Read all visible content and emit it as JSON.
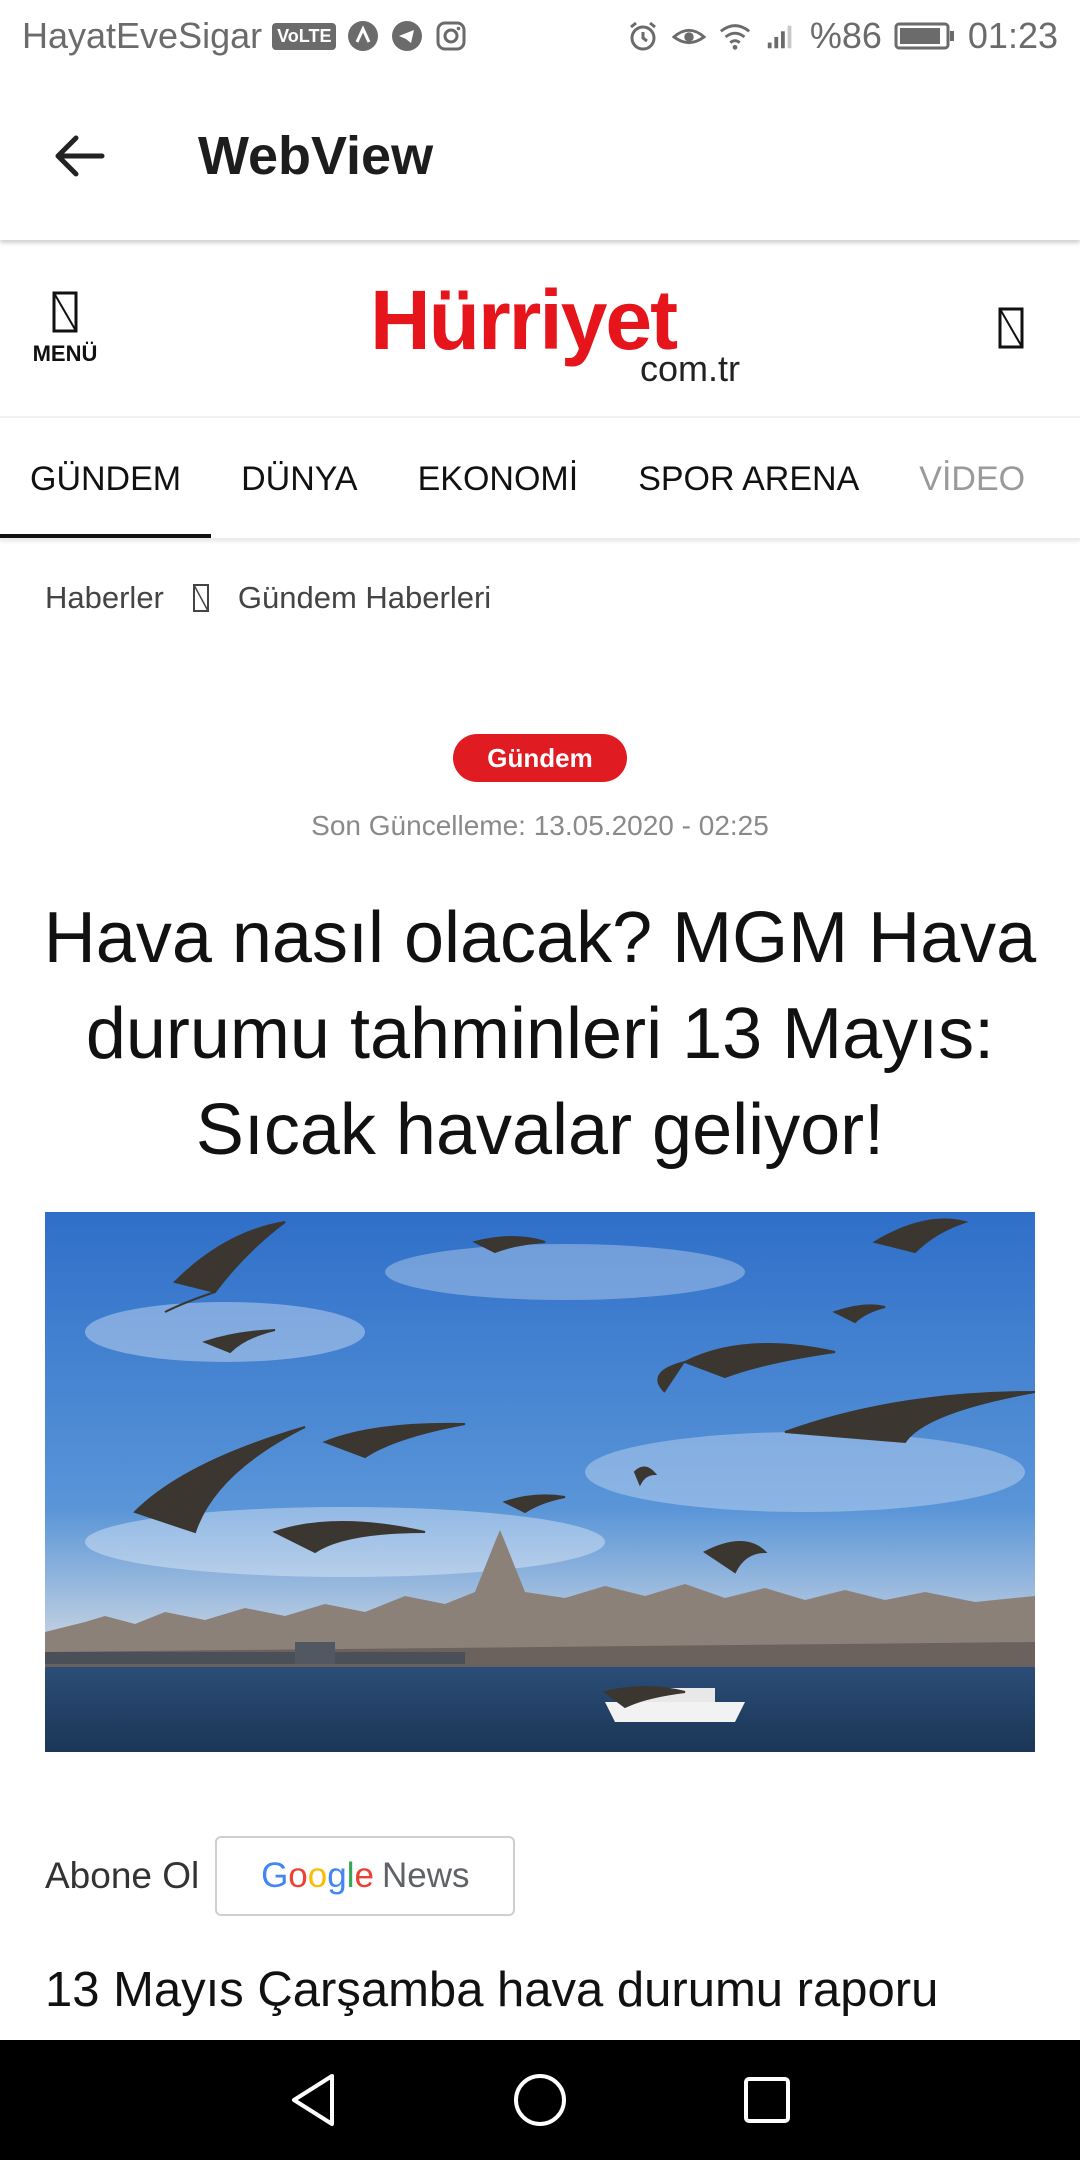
{
  "status_bar": {
    "carrier": "HayatEveSigar",
    "volte": "VoLTE",
    "battery": "%86",
    "time": "01:23"
  },
  "app_bar": {
    "title": "WebView"
  },
  "site": {
    "menu_label": "MENÜ",
    "logo_main": "Hürriyet",
    "logo_sub": "com.tr",
    "brand_color": "#e6141b"
  },
  "tabs": [
    {
      "label": "GÜNDEM",
      "active": true
    },
    {
      "label": "DÜNYA"
    },
    {
      "label": "EKONOMİ"
    },
    {
      "label": "SPOR ARENA"
    },
    {
      "label": "VİDEO"
    }
  ],
  "breadcrumb": {
    "items": [
      "Haberler",
      "Gündem Haberleri"
    ]
  },
  "article": {
    "category_badge": "Gündem",
    "updated": "Son Güncelleme: 13.05.2020 - 02:25",
    "headline": "Hava nasıl olacak? MGM Hava durumu tahminleri 13 Mayıs: Sıcak havalar geliyor!",
    "subscribe_label": "Abone Ol",
    "gnews_google": [
      "G",
      "o",
      "o",
      "g",
      "l",
      "e"
    ],
    "gnews_news": "News",
    "report_title": "13 Mayıs Çarşamba hava durumu raporu"
  }
}
